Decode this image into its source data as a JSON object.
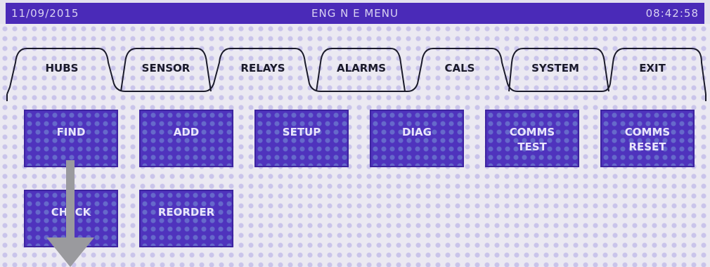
{
  "titlebar": {
    "date": "11/09/2015",
    "title": "ENG N E MENU",
    "time": "08:42:58"
  },
  "tabs": [
    {
      "label": "HUBS"
    },
    {
      "label": "SENSOR"
    },
    {
      "label": "RELAYS"
    },
    {
      "label": "ALARMS"
    },
    {
      "label": "CALS"
    },
    {
      "label": "SYSTEM"
    },
    {
      "label": "EXIT"
    }
  ],
  "buttons": {
    "find": "FIND",
    "add": "ADD",
    "setup": "SETUP",
    "diag": "DIAG",
    "comms_test": [
      "COMMS",
      "TEST"
    ],
    "comms_reset": [
      "COMMS",
      "RESET"
    ],
    "check": "CHECK",
    "reorder": "REORDER"
  },
  "colors": {
    "titlebar": "#4a2ab8",
    "button": "#4f33bd",
    "background": "#ebe9f2",
    "arrow": "#9a9a9e"
  },
  "icons": {
    "pointer": "down-arrow-icon"
  }
}
